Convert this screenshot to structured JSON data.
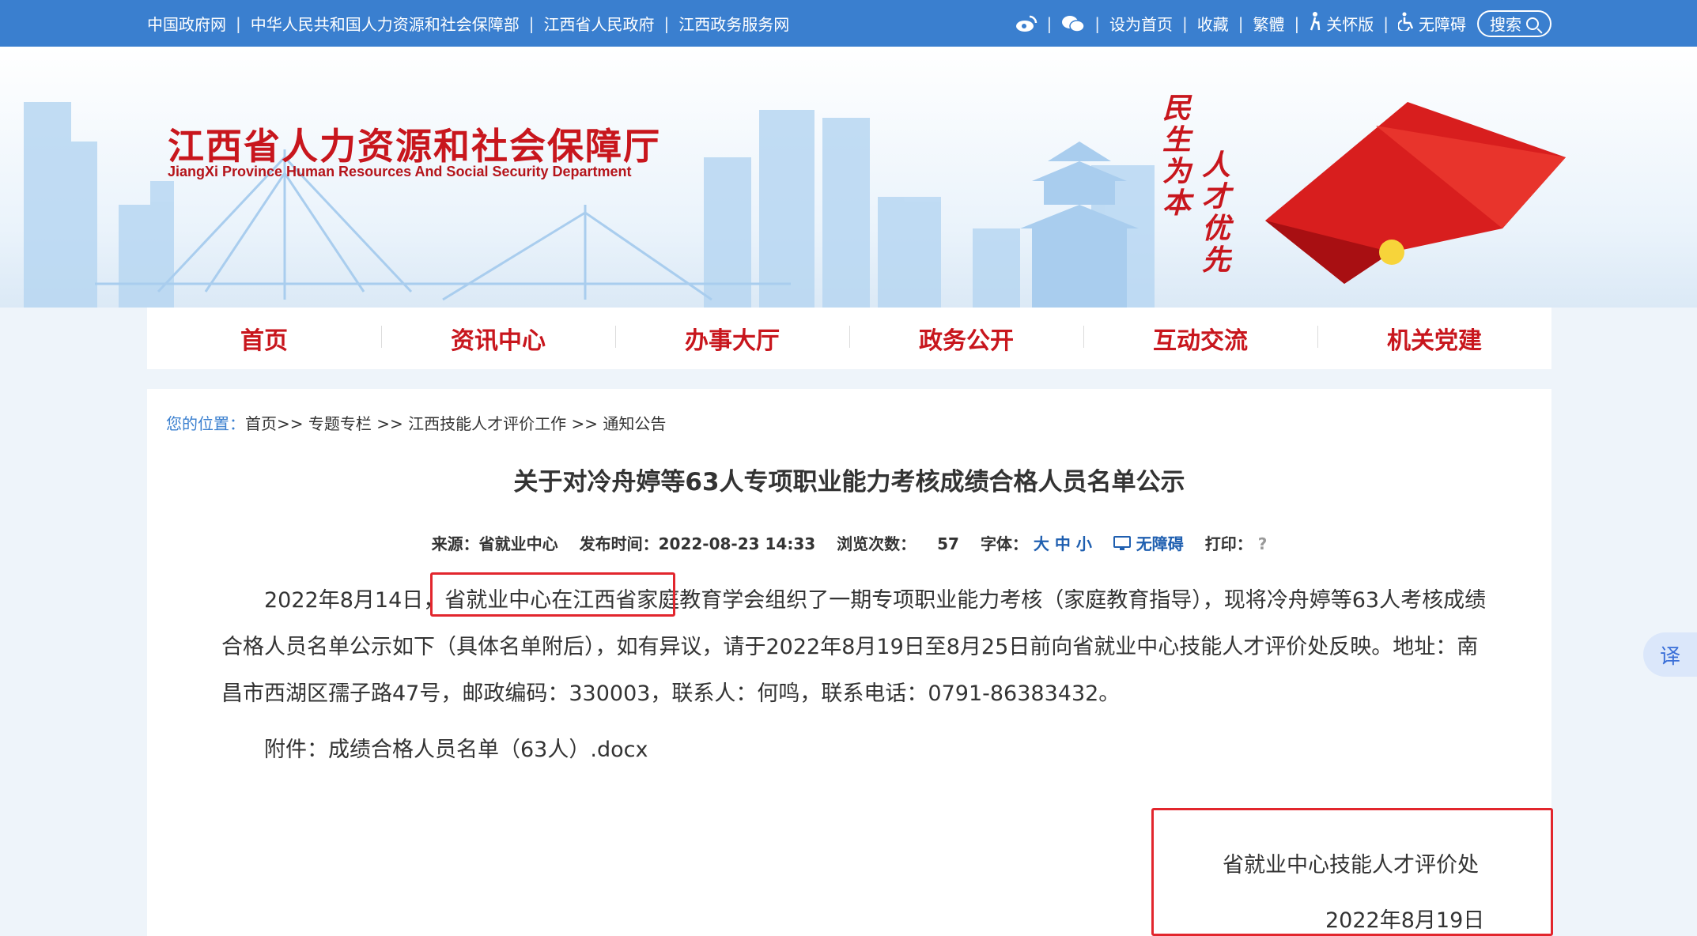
{
  "topbar": {
    "links": [
      "中国政府网",
      "中华人民共和国人力资源和社会保障部",
      "江西省人民政府",
      "江西政务服务网"
    ],
    "tools": {
      "set_home": "设为首页",
      "favorite": "收藏",
      "traditional": "繁體",
      "care_mode": "关怀版",
      "accessibility": "无障碍",
      "search": "搜索"
    }
  },
  "banner": {
    "title": "江西省人力资源和社会保障厅",
    "subtitle": "JiangXi Province Human Resources And Social Security Department",
    "slogan_a": "民生为本",
    "slogan_b": "人才优先"
  },
  "nav": {
    "items": [
      "首页",
      "资讯中心",
      "办事大厅",
      "政务公开",
      "互动交流",
      "机关党建"
    ]
  },
  "breadcrumb": {
    "label": "您的位置：",
    "path": "首页>> 专题专栏 >> 江西技能人才评价工作 >> 通知公告"
  },
  "article": {
    "title": "关于对冷舟婷等63人专项职业能力考核成绩合格人员名单公示",
    "meta": {
      "source": "来源：省就业中心",
      "publish": "发布时间：2022-08-23 14:33",
      "views_label": "浏览次数：",
      "views": "57",
      "font_label": "字体：",
      "font_sizes": "大 中 小",
      "accessible": "无障碍",
      "print": "打印：",
      "print_icon": "?"
    },
    "para1_lead": "2022年8月14日，",
    "para1_highlight": "省就业中心在江西省家庭教育学会",
    "para1_rest": "组织了一期专项职业能力考核（家庭教育指导），现将冷舟婷等63人考核成绩合格人员名单公示如下（具体名单附后），如有异议，请于2022年8月19日至8月25日前向省就业中心技能人才评价处反映。地址：南昌市西湖区孺子路47号，邮政编码：330003，联系人：何鸣，联系电话：0791-86383432。",
    "attachment": "附件：成绩合格人员名单（63人）.docx",
    "sign_org": "省就业中心技能人才评价处",
    "sign_date": "2022年8月19日"
  },
  "translate_label": "译",
  "colors": {
    "topbar": "#3a7fcf",
    "brand_red": "#c8161d",
    "highlight_box": "#e2262d"
  }
}
